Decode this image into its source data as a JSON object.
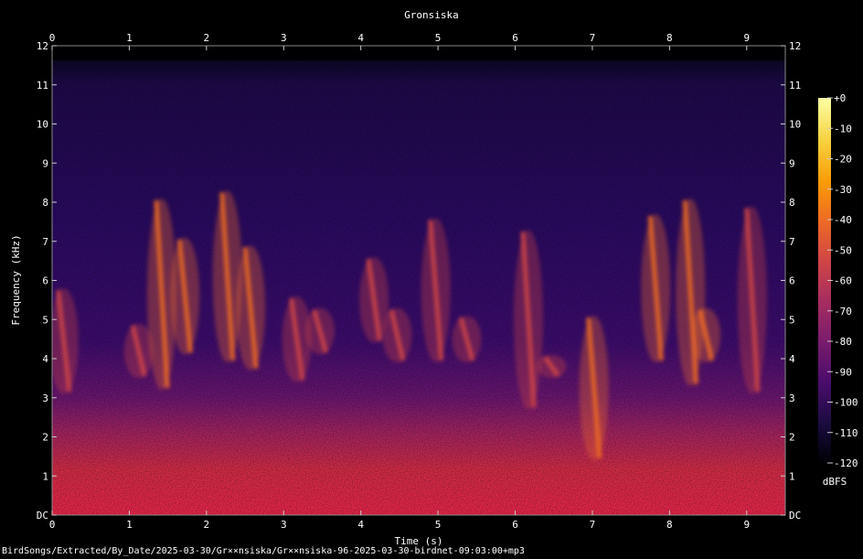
{
  "chart_data": {
    "type": "heatmap",
    "title": "Gronsiska",
    "xlabel": "Time (s)",
    "ylabel": "Frequency (kHz)",
    "x_ticks": [
      "0",
      "1",
      "2",
      "3",
      "4",
      "5",
      "6",
      "7",
      "8",
      "9"
    ],
    "x_range": [
      0,
      9.5
    ],
    "y_ticks": [
      "DC",
      "1",
      "2",
      "3",
      "4",
      "5",
      "6",
      "7",
      "8",
      "9",
      "10",
      "11",
      "12"
    ],
    "y_range": [
      0,
      12
    ],
    "colorbar": {
      "label": "dBFS",
      "ticks": [
        "+0",
        "-10",
        "-20",
        "-30",
        "-40",
        "-50",
        "-60",
        "-70",
        "-80",
        "-90",
        "-100",
        "-110",
        "-120"
      ],
      "range": [
        -120,
        0
      ],
      "colormap": [
        "#000004",
        "#1b0c41",
        "#4a0c6b",
        "#781c6d",
        "#a52c60",
        "#cf4446",
        "#ed6925",
        "#fb9b06",
        "#f7d13d",
        "#fcffa4"
      ]
    },
    "calls": [
      {
        "t": 0.08,
        "f_high": 5.7,
        "f_low": 3.2,
        "level_db": -55
      },
      {
        "t": 1.05,
        "f_high": 4.8,
        "f_low": 3.6,
        "level_db": -60
      },
      {
        "t": 1.35,
        "f_high": 8.0,
        "f_low": 3.3,
        "level_db": -45
      },
      {
        "t": 1.65,
        "f_high": 7.0,
        "f_low": 4.2,
        "level_db": -40
      },
      {
        "t": 2.2,
        "f_high": 8.2,
        "f_low": 4.0,
        "level_db": -42
      },
      {
        "t": 2.5,
        "f_high": 6.8,
        "f_low": 3.8,
        "level_db": -45
      },
      {
        "t": 3.1,
        "f_high": 5.5,
        "f_low": 3.5,
        "level_db": -55
      },
      {
        "t": 3.4,
        "f_high": 5.2,
        "f_low": 4.2,
        "level_db": -60
      },
      {
        "t": 4.1,
        "f_high": 6.5,
        "f_low": 4.5,
        "level_db": -55
      },
      {
        "t": 4.4,
        "f_high": 5.2,
        "f_low": 4.0,
        "level_db": -60
      },
      {
        "t": 4.9,
        "f_high": 7.5,
        "f_low": 4.0,
        "level_db": -52
      },
      {
        "t": 5.3,
        "f_high": 5.0,
        "f_low": 4.0,
        "level_db": -55
      },
      {
        "t": 6.1,
        "f_high": 7.2,
        "f_low": 2.8,
        "level_db": -48
      },
      {
        "t": 6.4,
        "f_high": 4.0,
        "f_low": 3.6,
        "level_db": -55
      },
      {
        "t": 6.95,
        "f_high": 5.0,
        "f_low": 1.5,
        "level_db": -35
      },
      {
        "t": 7.75,
        "f_high": 7.6,
        "f_low": 4.0,
        "level_db": -45
      },
      {
        "t": 8.2,
        "f_high": 8.0,
        "f_low": 3.4,
        "level_db": -42
      },
      {
        "t": 8.4,
        "f_high": 5.2,
        "f_low": 4.0,
        "level_db": -38
      },
      {
        "t": 9.0,
        "f_high": 7.8,
        "f_low": 3.2,
        "level_db": -50
      }
    ]
  },
  "footer": {
    "path": "BirdSongs/Extracted/By_Date/2025-03-30/Gr××nsiska/Gr××nsiska-96-2025-03-30-birdnet-09:03:00+mp3"
  }
}
